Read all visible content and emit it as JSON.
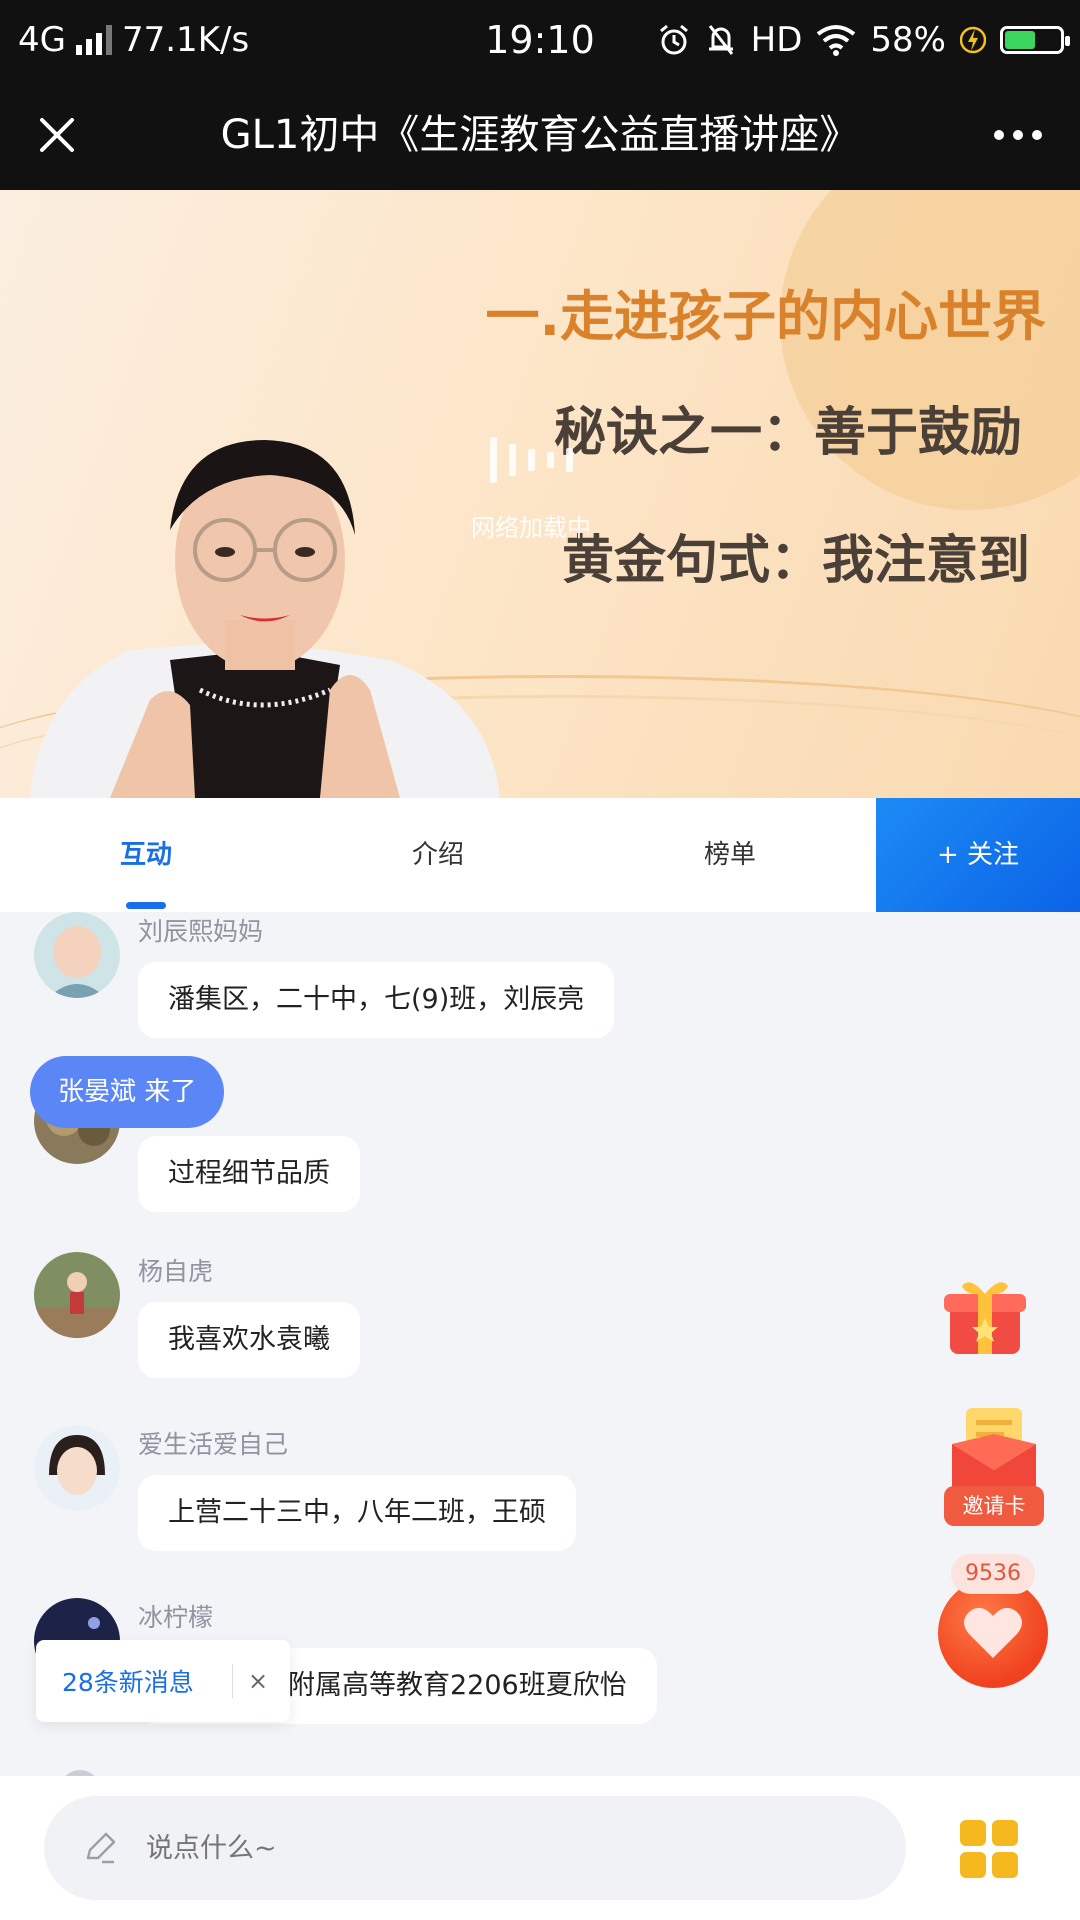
{
  "status_bar": {
    "network": "4G",
    "speed": "77.1K/s",
    "time": "19:10",
    "hd": "HD",
    "battery": "58%",
    "battery_level": 0.58,
    "icons": [
      "signal-icon",
      "alarm-icon",
      "mute-icon",
      "wifi-icon",
      "charging-icon",
      "battery-icon"
    ]
  },
  "header": {
    "title": "GL1初中《生涯教育公益直播讲座》",
    "close_icon": "close-icon",
    "more_icon": "more-icon"
  },
  "video": {
    "slide_heading": "一.走进孩子的内心世界",
    "slide_line_1": "秘诀之一：善于鼓励",
    "slide_line_2": "黄金句式：我注意到",
    "loading_text": "网络加载中",
    "colors": {
      "heading": "#d9822b",
      "body": "#4a4038"
    }
  },
  "tabs": {
    "items": [
      {
        "label": "互动",
        "active": true
      },
      {
        "label": "介绍",
        "active": false
      },
      {
        "label": "榜单",
        "active": false
      }
    ],
    "follow_label": "+ 关注",
    "accent": "#1a6fe8"
  },
  "chat": {
    "messages": [
      {
        "user": "刘辰熙妈妈",
        "text": "潘集区，二十中，七(9)班，刘辰亮"
      },
      {
        "user": "",
        "text": "过程细节品质"
      },
      {
        "user": "杨自虎",
        "text": "我喜欢水袁曦"
      },
      {
        "user": "爱生活爱自己",
        "text": "上营二十三中，八年二班，王硕"
      },
      {
        "user": "冰柠檬",
        "text": "附属高等教育2206班夏欣怡"
      }
    ],
    "join_notice": "张晏斌 来了",
    "new_messages": "28条新消息",
    "new_messages_close": "×"
  },
  "floating": {
    "gift_icon": "gift-icon",
    "invite_label": "邀请卡",
    "like_count": "9536",
    "like_icon": "heart-icon"
  },
  "input": {
    "placeholder": "说点什么~",
    "menu_icon": "grid-menu-icon"
  }
}
